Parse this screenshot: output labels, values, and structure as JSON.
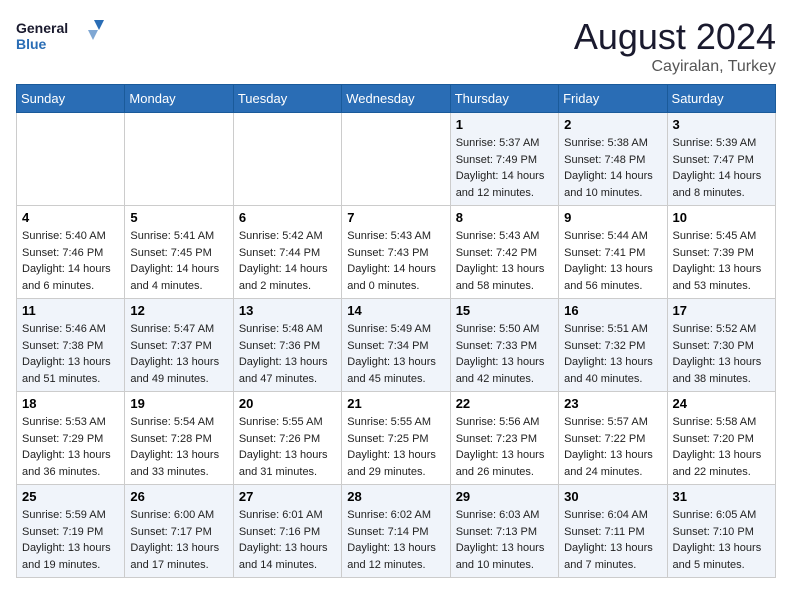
{
  "header": {
    "logo_general": "General",
    "logo_blue": "Blue",
    "month": "August 2024",
    "location": "Cayiralan, Turkey"
  },
  "weekdays": [
    "Sunday",
    "Monday",
    "Tuesday",
    "Wednesday",
    "Thursday",
    "Friday",
    "Saturday"
  ],
  "weeks": [
    [
      {
        "day": "",
        "info": ""
      },
      {
        "day": "",
        "info": ""
      },
      {
        "day": "",
        "info": ""
      },
      {
        "day": "",
        "info": ""
      },
      {
        "day": "1",
        "info": "Sunrise: 5:37 AM\nSunset: 7:49 PM\nDaylight: 14 hours\nand 12 minutes."
      },
      {
        "day": "2",
        "info": "Sunrise: 5:38 AM\nSunset: 7:48 PM\nDaylight: 14 hours\nand 10 minutes."
      },
      {
        "day": "3",
        "info": "Sunrise: 5:39 AM\nSunset: 7:47 PM\nDaylight: 14 hours\nand 8 minutes."
      }
    ],
    [
      {
        "day": "4",
        "info": "Sunrise: 5:40 AM\nSunset: 7:46 PM\nDaylight: 14 hours\nand 6 minutes."
      },
      {
        "day": "5",
        "info": "Sunrise: 5:41 AM\nSunset: 7:45 PM\nDaylight: 14 hours\nand 4 minutes."
      },
      {
        "day": "6",
        "info": "Sunrise: 5:42 AM\nSunset: 7:44 PM\nDaylight: 14 hours\nand 2 minutes."
      },
      {
        "day": "7",
        "info": "Sunrise: 5:43 AM\nSunset: 7:43 PM\nDaylight: 14 hours\nand 0 minutes."
      },
      {
        "day": "8",
        "info": "Sunrise: 5:43 AM\nSunset: 7:42 PM\nDaylight: 13 hours\nand 58 minutes."
      },
      {
        "day": "9",
        "info": "Sunrise: 5:44 AM\nSunset: 7:41 PM\nDaylight: 13 hours\nand 56 minutes."
      },
      {
        "day": "10",
        "info": "Sunrise: 5:45 AM\nSunset: 7:39 PM\nDaylight: 13 hours\nand 53 minutes."
      }
    ],
    [
      {
        "day": "11",
        "info": "Sunrise: 5:46 AM\nSunset: 7:38 PM\nDaylight: 13 hours\nand 51 minutes."
      },
      {
        "day": "12",
        "info": "Sunrise: 5:47 AM\nSunset: 7:37 PM\nDaylight: 13 hours\nand 49 minutes."
      },
      {
        "day": "13",
        "info": "Sunrise: 5:48 AM\nSunset: 7:36 PM\nDaylight: 13 hours\nand 47 minutes."
      },
      {
        "day": "14",
        "info": "Sunrise: 5:49 AM\nSunset: 7:34 PM\nDaylight: 13 hours\nand 45 minutes."
      },
      {
        "day": "15",
        "info": "Sunrise: 5:50 AM\nSunset: 7:33 PM\nDaylight: 13 hours\nand 42 minutes."
      },
      {
        "day": "16",
        "info": "Sunrise: 5:51 AM\nSunset: 7:32 PM\nDaylight: 13 hours\nand 40 minutes."
      },
      {
        "day": "17",
        "info": "Sunrise: 5:52 AM\nSunset: 7:30 PM\nDaylight: 13 hours\nand 38 minutes."
      }
    ],
    [
      {
        "day": "18",
        "info": "Sunrise: 5:53 AM\nSunset: 7:29 PM\nDaylight: 13 hours\nand 36 minutes."
      },
      {
        "day": "19",
        "info": "Sunrise: 5:54 AM\nSunset: 7:28 PM\nDaylight: 13 hours\nand 33 minutes."
      },
      {
        "day": "20",
        "info": "Sunrise: 5:55 AM\nSunset: 7:26 PM\nDaylight: 13 hours\nand 31 minutes."
      },
      {
        "day": "21",
        "info": "Sunrise: 5:55 AM\nSunset: 7:25 PM\nDaylight: 13 hours\nand 29 minutes."
      },
      {
        "day": "22",
        "info": "Sunrise: 5:56 AM\nSunset: 7:23 PM\nDaylight: 13 hours\nand 26 minutes."
      },
      {
        "day": "23",
        "info": "Sunrise: 5:57 AM\nSunset: 7:22 PM\nDaylight: 13 hours\nand 24 minutes."
      },
      {
        "day": "24",
        "info": "Sunrise: 5:58 AM\nSunset: 7:20 PM\nDaylight: 13 hours\nand 22 minutes."
      }
    ],
    [
      {
        "day": "25",
        "info": "Sunrise: 5:59 AM\nSunset: 7:19 PM\nDaylight: 13 hours\nand 19 minutes."
      },
      {
        "day": "26",
        "info": "Sunrise: 6:00 AM\nSunset: 7:17 PM\nDaylight: 13 hours\nand 17 minutes."
      },
      {
        "day": "27",
        "info": "Sunrise: 6:01 AM\nSunset: 7:16 PM\nDaylight: 13 hours\nand 14 minutes."
      },
      {
        "day": "28",
        "info": "Sunrise: 6:02 AM\nSunset: 7:14 PM\nDaylight: 13 hours\nand 12 minutes."
      },
      {
        "day": "29",
        "info": "Sunrise: 6:03 AM\nSunset: 7:13 PM\nDaylight: 13 hours\nand 10 minutes."
      },
      {
        "day": "30",
        "info": "Sunrise: 6:04 AM\nSunset: 7:11 PM\nDaylight: 13 hours\nand 7 minutes."
      },
      {
        "day": "31",
        "info": "Sunrise: 6:05 AM\nSunset: 7:10 PM\nDaylight: 13 hours\nand 5 minutes."
      }
    ]
  ]
}
